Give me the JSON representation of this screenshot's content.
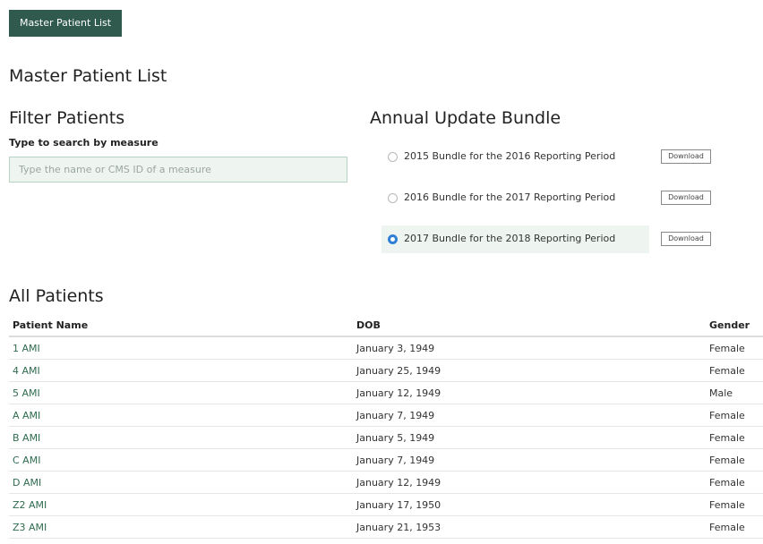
{
  "nav": {
    "tab_label": "Master Patient List"
  },
  "page_title": "Master Patient List",
  "filter": {
    "title": "Filter Patients",
    "label": "Type to search by measure",
    "placeholder": "Type the name or CMS ID of a measure",
    "value": ""
  },
  "bundle": {
    "title": "Annual Update Bundle",
    "options": [
      {
        "label": "2015 Bundle for the 2016 Reporting Period",
        "selected": false,
        "download_label": "Download"
      },
      {
        "label": "2016 Bundle for the 2017 Reporting Period",
        "selected": false,
        "download_label": "Download"
      },
      {
        "label": "2017 Bundle for the 2018 Reporting Period",
        "selected": true,
        "download_label": "Download"
      }
    ]
  },
  "patients": {
    "title": "All Patients",
    "columns": {
      "name": "Patient Name",
      "dob": "DOB",
      "gender": "Gender"
    },
    "rows": [
      {
        "name": "1 AMI",
        "dob": "January 3, 1949",
        "gender": "Female"
      },
      {
        "name": "4 AMI",
        "dob": "January 25, 1949",
        "gender": "Female"
      },
      {
        "name": "5 AMI",
        "dob": "January 12, 1949",
        "gender": "Male"
      },
      {
        "name": "A AMI",
        "dob": "January 7, 1949",
        "gender": "Female"
      },
      {
        "name": "B AMI",
        "dob": "January 5, 1949",
        "gender": "Female"
      },
      {
        "name": "C AMI",
        "dob": "January 7, 1949",
        "gender": "Female"
      },
      {
        "name": "D AMI",
        "dob": "January 12, 1949",
        "gender": "Female"
      },
      {
        "name": "Z2 AMI",
        "dob": "January 17, 1950",
        "gender": "Female"
      },
      {
        "name": "Z3 AMI",
        "dob": "January 21, 1953",
        "gender": "Female"
      }
    ]
  },
  "colors": {
    "accent": "#2f5a4d",
    "link": "#2f6b4f",
    "highlight": "#eef5f0",
    "radio_selected": "#2f7fd6"
  }
}
